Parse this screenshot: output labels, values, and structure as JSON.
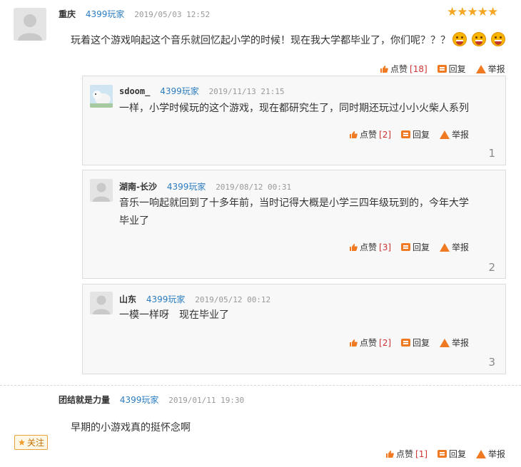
{
  "main_comment": {
    "user": "重庆",
    "tag": "4399玩家",
    "time": "2019/05/03 12:52",
    "rating": 5,
    "text": "玩着这个游戏响起这个音乐就回忆起小学的时候！现在我大学都毕业了，你们呢？？？",
    "like_label": "点赞",
    "like_count": "[18]",
    "reply_label": "回复",
    "report_label": "举报"
  },
  "replies": [
    {
      "user": "sdoom_",
      "tag": "4399玩家",
      "time": "2019/11/13 21:15",
      "text": "一样，小学时候玩的这个游戏，现在都研究生了，同时期还玩过小小火柴人系列",
      "like_label": "点赞",
      "like_count": "[2]",
      "reply_label": "回复",
      "report_label": "举报",
      "floor": "1"
    },
    {
      "user": "湖南-长沙",
      "tag": "4399玩家",
      "time": "2019/08/12 00:31",
      "text": "音乐一响起就回到了十多年前，当时记得大概是小学三四年级玩到的，今年大学毕业了",
      "like_label": "点赞",
      "like_count": "[3]",
      "reply_label": "回复",
      "report_label": "举报",
      "floor": "2"
    },
    {
      "user": "山东",
      "tag": "4399玩家",
      "time": "2019/05/12 00:12",
      "text": "一模一样呀　现在毕业了",
      "like_label": "点赞",
      "like_count": "[2]",
      "reply_label": "回复",
      "report_label": "举报",
      "floor": "3"
    }
  ],
  "second_comment": {
    "user": "团结就是力量",
    "tag": "4399玩家",
    "time": "2019/01/11 19:30",
    "text": "早期的小游戏真的挺怀念啊",
    "follow_label": "关注",
    "like_label": "点赞",
    "like_count": "[1]",
    "reply_label": "回复",
    "report_label": "举报"
  },
  "colors": {
    "accent": "#ef7a22",
    "tag": "#2b7cc0",
    "star": "#f5a623"
  },
  "icons": [
    "default-avatar-icon",
    "star-icon",
    "grin-emoji-icon",
    "thumbs-up-icon",
    "reply-icon",
    "report-warning-icon",
    "polar-bear-avatar"
  ]
}
